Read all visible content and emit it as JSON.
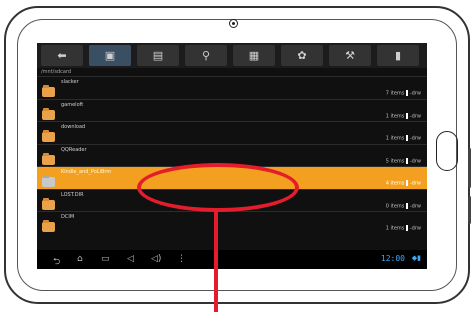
{
  "toolbar": {
    "tabs": [
      {
        "icon": "back-arrow-icon",
        "glyph": "⬅"
      },
      {
        "icon": "sd-card-icon",
        "glyph": "▣"
      },
      {
        "icon": "document-icon",
        "glyph": "▤"
      },
      {
        "icon": "usb-icon",
        "glyph": "⚲"
      },
      {
        "icon": "image-icon",
        "glyph": "▦"
      },
      {
        "icon": "film-reel-icon",
        "glyph": "✿"
      },
      {
        "icon": "tools-icon",
        "glyph": "⚒"
      },
      {
        "icon": "file-icon",
        "glyph": "▮"
      }
    ]
  },
  "path": "/mnt/sdcard",
  "folders": [
    {
      "name": "slacker",
      "count": "7 items",
      "perm": "-drw"
    },
    {
      "name": "gameloft",
      "count": "1 items",
      "perm": "-drw"
    },
    {
      "name": "download",
      "count": "1 items",
      "perm": "-drw"
    },
    {
      "name": "QQReader",
      "count": "5 items",
      "perm": "-drw"
    },
    {
      "name": "Kindle_and_PoLiBrm",
      "count": "4 items",
      "perm": "-drw",
      "selected": true
    },
    {
      "name": "LOST.DIR",
      "count": "0 items",
      "perm": "-drw"
    },
    {
      "name": "DCIM",
      "count": "1 items",
      "perm": "-drw"
    }
  ],
  "navbar": {
    "clock": "12:00",
    "buttons": [
      "back-icon",
      "home-icon",
      "recent-apps-icon",
      "volume-down-icon",
      "volume-up-icon",
      "menu-icon"
    ],
    "glyphs": [
      "⮌",
      "⌂",
      "▭",
      "◁",
      "◁)",
      "⋮"
    ]
  },
  "colors": {
    "selected": "#f3a020",
    "annotation": "#e31d2b",
    "clock": "#3fa9f5"
  }
}
